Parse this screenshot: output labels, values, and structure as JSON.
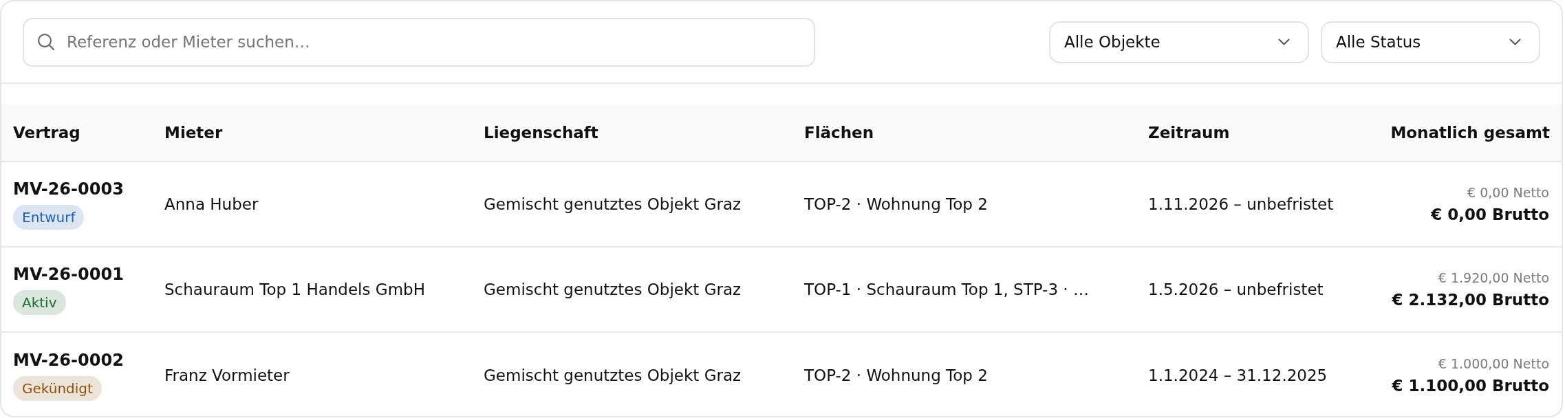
{
  "search": {
    "placeholder": "Referenz oder Mieter suchen…"
  },
  "filters": [
    {
      "value": "Alle Objekte"
    },
    {
      "value": "Alle Status"
    }
  ],
  "table": {
    "columns": [
      "Vertrag",
      "Mieter",
      "Liegenschaft",
      "Flächen",
      "Zeitraum",
      "Monatlich gesamt"
    ],
    "rows": [
      {
        "contract": "MV-26-0003",
        "status": {
          "label": "Entwurf",
          "color": "#1d5fa8"
        },
        "tenant": "Anna Huber",
        "property": "Gemischt genutztes Objekt Graz",
        "units": "TOP-2 · Wohnung Top 2",
        "period": "1.11.2026 – unbefristet",
        "net": "€ 0,00 Netto",
        "gross": "€ 0,00 Brutto"
      },
      {
        "contract": "MV-26-0001",
        "status": {
          "label": "Aktiv",
          "color": "#1b6b2e"
        },
        "tenant": "Schauraum Top 1 Handels GmbH",
        "property": "Gemischt genutztes Objekt Graz",
        "units": "TOP-1 · Schauraum Top 1, STP-3 · …",
        "period": "1.5.2026 – unbefristet",
        "net": "€ 1.920,00 Netto",
        "gross": "€ 2.132,00 Brutto"
      },
      {
        "contract": "MV-26-0002",
        "status": {
          "label": "Gekündigt",
          "color": "#8a5510"
        },
        "tenant": "Franz Vormieter",
        "property": "Gemischt genutztes Objekt Graz",
        "units": "TOP-2 · Wohnung Top 2",
        "period": "1.1.2024 – 31.12.2025",
        "net": "€ 1.000,00 Netto",
        "gross": "€ 1.100,00 Brutto"
      }
    ]
  }
}
